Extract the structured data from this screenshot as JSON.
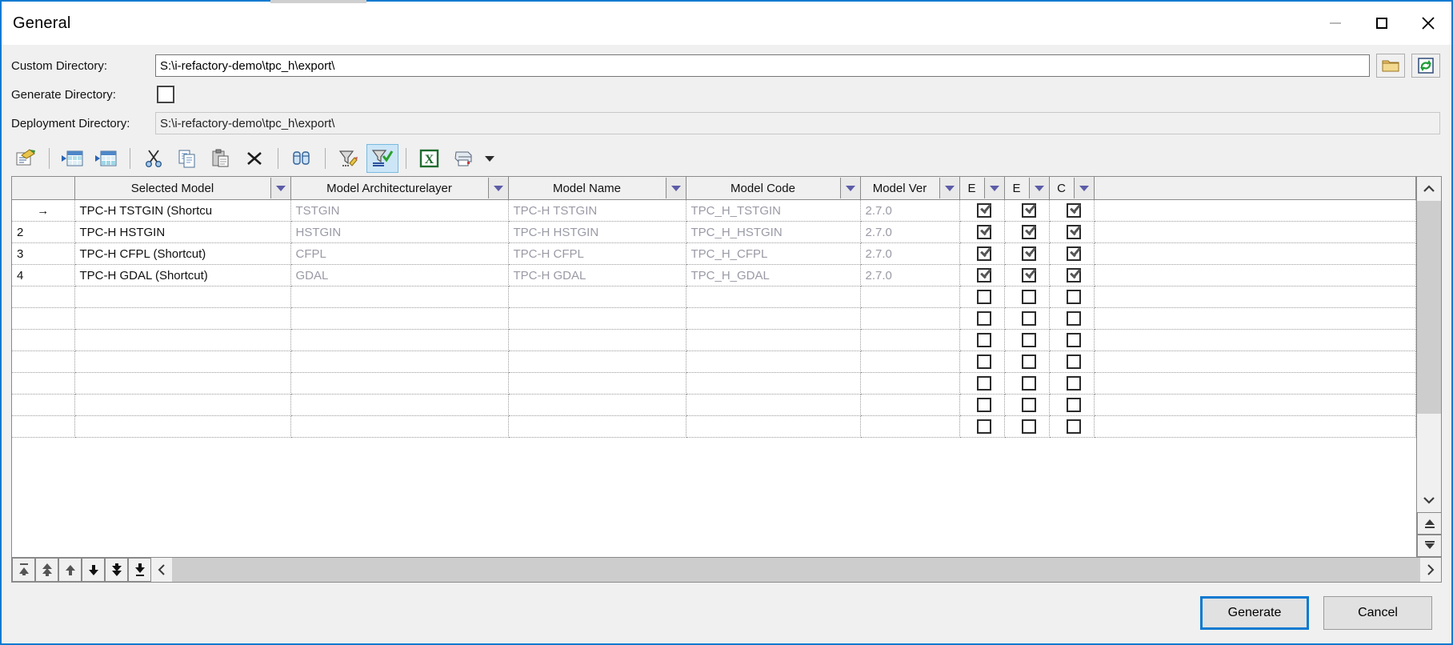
{
  "window": {
    "title": "General",
    "accent_color": "#0b7ad1",
    "controls": [
      {
        "name": "minimize",
        "glyph": "minimize-icon",
        "disabled": true
      },
      {
        "name": "maximize",
        "glyph": "maximize-icon",
        "disabled": false
      },
      {
        "name": "close",
        "glyph": "close-icon",
        "disabled": false
      }
    ]
  },
  "form": {
    "custom_directory": {
      "label": "Custom Directory:",
      "value": "S:\\i-refactory-demo\\tpc_h\\export\\",
      "browse_icon": "folder-icon",
      "refresh_icon": "refresh-icon"
    },
    "generate_directory": {
      "label": "Generate Directory:",
      "checked": false
    },
    "deployment_directory": {
      "label": "Deployment Directory:",
      "value": "S:\\i-refactory-demo\\tpc_h\\export\\",
      "readonly": true
    }
  },
  "toolbar": {
    "items": [
      {
        "icon": "properties-icon",
        "label": "Properties",
        "active": false
      },
      {
        "sep": true
      },
      {
        "icon": "insert-row-icon",
        "label": "Insert Row",
        "active": false
      },
      {
        "icon": "add-row-icon",
        "label": "Add Row",
        "active": false
      },
      {
        "sep": true
      },
      {
        "icon": "cut-icon",
        "label": "Cut",
        "active": false
      },
      {
        "icon": "copy-icon",
        "label": "Copy",
        "active": false
      },
      {
        "icon": "paste-icon",
        "label": "Paste",
        "active": false
      },
      {
        "icon": "delete-icon",
        "label": "Delete",
        "active": false
      },
      {
        "sep": true
      },
      {
        "icon": "find-icon",
        "label": "Find",
        "active": false
      },
      {
        "sep": true
      },
      {
        "icon": "edit-filter-icon",
        "label": "Edit Filter",
        "active": false
      },
      {
        "icon": "apply-filter-icon",
        "label": "Apply Filter",
        "active": true
      },
      {
        "sep": true
      },
      {
        "icon": "excel-export-icon",
        "label": "Export to Excel",
        "active": false
      },
      {
        "icon": "print-icon",
        "label": "Print",
        "active": false
      },
      {
        "icon": "chevron-down-icon",
        "label": "More",
        "active": false
      }
    ]
  },
  "grid": {
    "columns": [
      {
        "key": "row",
        "label": "",
        "dropdown": false
      },
      {
        "key": "selected_model",
        "label": "Selected Model",
        "dropdown": true
      },
      {
        "key": "model_architecturelayer",
        "label": "Model Architecturelayer",
        "dropdown": true
      },
      {
        "key": "model_name",
        "label": "Model Name",
        "dropdown": true
      },
      {
        "key": "model_code",
        "label": "Model Code",
        "dropdown": true
      },
      {
        "key": "model_ver",
        "label": "Model Ver",
        "dropdown": true
      },
      {
        "key": "e1",
        "label": "E",
        "dropdown": true
      },
      {
        "key": "e2",
        "label": "E",
        "dropdown": true
      },
      {
        "key": "c1",
        "label": "C",
        "dropdown": true
      },
      {
        "key": "filler",
        "label": "",
        "dropdown": false
      }
    ],
    "rows": [
      {
        "row": "→",
        "current": true,
        "selected_model": "TPC-H TSTGIN (Shortcu",
        "model_architecturelayer": "TSTGIN",
        "model_name": "TPC-H TSTGIN",
        "model_code": "TPC_H_TSTGIN",
        "model_ver": "2.7.0",
        "e1": true,
        "e2": true,
        "c1": true
      },
      {
        "row": "2",
        "current": false,
        "selected_model": "TPC-H HSTGIN",
        "model_architecturelayer": "HSTGIN",
        "model_name": "TPC-H HSTGIN",
        "model_code": "TPC_H_HSTGIN",
        "model_ver": "2.7.0",
        "e1": true,
        "e2": true,
        "c1": true
      },
      {
        "row": "3",
        "current": false,
        "selected_model": "TPC-H CFPL (Shortcut)",
        "model_architecturelayer": "CFPL",
        "model_name": "TPC-H CFPL",
        "model_code": "TPC_H_CFPL",
        "model_ver": "2.7.0",
        "e1": true,
        "e2": true,
        "c1": true
      },
      {
        "row": "4",
        "current": false,
        "selected_model": "TPC-H GDAL (Shortcut)",
        "model_architecturelayer": "GDAL",
        "model_name": "TPC-H GDAL",
        "model_code": "TPC_H_GDAL",
        "model_ver": "2.7.0",
        "e1": true,
        "e2": true,
        "c1": true
      },
      {
        "row": "",
        "current": false,
        "selected_model": "",
        "model_architecturelayer": "",
        "model_name": "",
        "model_code": "",
        "model_ver": "",
        "e1": false,
        "e2": false,
        "c1": false
      },
      {
        "row": "",
        "current": false,
        "selected_model": "",
        "model_architecturelayer": "",
        "model_name": "",
        "model_code": "",
        "model_ver": "",
        "e1": false,
        "e2": false,
        "c1": false
      },
      {
        "row": "",
        "current": false,
        "selected_model": "",
        "model_architecturelayer": "",
        "model_name": "",
        "model_code": "",
        "model_ver": "",
        "e1": false,
        "e2": false,
        "c1": false
      },
      {
        "row": "",
        "current": false,
        "selected_model": "",
        "model_architecturelayer": "",
        "model_name": "",
        "model_code": "",
        "model_ver": "",
        "e1": false,
        "e2": false,
        "c1": false
      },
      {
        "row": "",
        "current": false,
        "selected_model": "",
        "model_architecturelayer": "",
        "model_name": "",
        "model_code": "",
        "model_ver": "",
        "e1": false,
        "e2": false,
        "c1": false
      },
      {
        "row": "",
        "current": false,
        "selected_model": "",
        "model_architecturelayer": "",
        "model_name": "",
        "model_code": "",
        "model_ver": "",
        "e1": false,
        "e2": false,
        "c1": false
      },
      {
        "row": "",
        "current": false,
        "selected_model": "",
        "model_architecturelayer": "",
        "model_name": "",
        "model_code": "",
        "model_ver": "",
        "e1": false,
        "e2": false,
        "c1": false
      }
    ],
    "nav_buttons": [
      {
        "name": "first-record-button",
        "icon": "first-record-icon"
      },
      {
        "name": "prior-page-button",
        "icon": "prior-page-icon"
      },
      {
        "name": "prior-record-button",
        "icon": "prior-record-icon"
      },
      {
        "name": "next-record-button",
        "icon": "next-record-icon"
      },
      {
        "name": "next-page-button",
        "icon": "next-page-icon"
      },
      {
        "name": "last-record-button",
        "icon": "last-record-icon"
      }
    ],
    "vscroll": {
      "up": "scroll-up-icon",
      "down": "scroll-down-icon",
      "top": "scroll-top-icon",
      "bottom": "scroll-bottom-icon"
    },
    "hscroll": {
      "left": "scroll-left-icon",
      "right": "scroll-right-icon"
    }
  },
  "footer": {
    "generate_label": "Generate",
    "cancel_label": "Cancel"
  }
}
